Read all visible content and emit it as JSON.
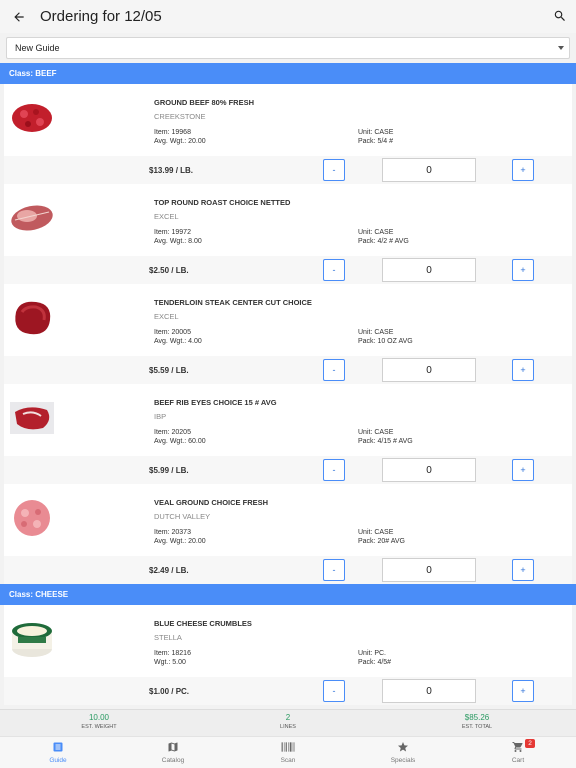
{
  "header": {
    "title": "Ordering for 12/05"
  },
  "guide_select": {
    "value": "New Guide"
  },
  "sections": [
    {
      "class_label": "Class: BEEF",
      "items": [
        {
          "name": "GROUND BEEF 80% FRESH",
          "brand": "CREEKSTONE",
          "item": "Item: 19968",
          "weight": "Avg. Wgt.: 20.00",
          "unit": "Unit: CASE",
          "pack": "Pack: 5/4 #",
          "price": "$13.99 / LB.",
          "qty": "0",
          "thumb": "ground-beef"
        },
        {
          "name": "TOP ROUND ROAST CHOICE NETTED",
          "brand": "EXCEL",
          "item": "Item: 19972",
          "weight": "Avg. Wgt.: 8.00",
          "unit": "Unit: CASE",
          "pack": "Pack: 4/2 # AVG",
          "price": "$2.50 / LB.",
          "qty": "0",
          "thumb": "roast"
        },
        {
          "name": "TENDERLOIN STEAK CENTER CUT CHOICE",
          "brand": "EXCEL",
          "item": "Item: 20005",
          "weight": "Avg. Wgt.: 4.00",
          "unit": "Unit: CASE",
          "pack": "Pack: 10 OZ AVG",
          "price": "$5.59 / LB.",
          "qty": "0",
          "thumb": "tenderloin"
        },
        {
          "name": "BEEF RIB EYES CHOICE 15 # AVG",
          "brand": "IBP",
          "item": "Item: 20205",
          "weight": "Avg. Wgt.: 60.00",
          "unit": "Unit: CASE",
          "pack": "Pack: 4/15 # AVG",
          "price": "$5.99 / LB.",
          "qty": "0",
          "thumb": "ribeye"
        },
        {
          "name": "VEAL GROUND CHOICE FRESH",
          "brand": "DUTCH VALLEY",
          "item": "Item: 20373",
          "weight": "Avg. Wgt.: 20.00",
          "unit": "Unit: CASE",
          "pack": "Pack: 20# AVG",
          "price": "$2.49 / LB.",
          "qty": "0",
          "thumb": "veal"
        }
      ]
    },
    {
      "class_label": "Class: CHEESE",
      "items": [
        {
          "name": "BLUE CHEESE CRUMBLES",
          "brand": "STELLA",
          "item": "Item: 18216",
          "weight": "Wgt.: 5.00",
          "unit": "Unit: PC.",
          "pack": "Pack: 4/5#",
          "price": "$1.00 / PC.",
          "qty": "0",
          "thumb": "blue-cheese"
        }
      ]
    }
  ],
  "buttons": {
    "minus": "-",
    "plus": "+"
  },
  "summary": [
    {
      "value": "10.00",
      "label": "EST. WEIGHT"
    },
    {
      "value": "2",
      "label": "LINES"
    },
    {
      "value": "$85.26",
      "label": "EST. TOTAL"
    }
  ],
  "tabs": [
    {
      "label": "Guide",
      "icon": "guide-icon"
    },
    {
      "label": "Catalog",
      "icon": "catalog-icon"
    },
    {
      "label": "Scan",
      "icon": "barcode-icon"
    },
    {
      "label": "Specials",
      "icon": "star-icon"
    },
    {
      "label": "Cart",
      "icon": "cart-icon",
      "badge": "2"
    }
  ],
  "colors": {
    "accent": "#4a8df8",
    "summary_value": "#2a9a62",
    "badge": "#e53935"
  }
}
